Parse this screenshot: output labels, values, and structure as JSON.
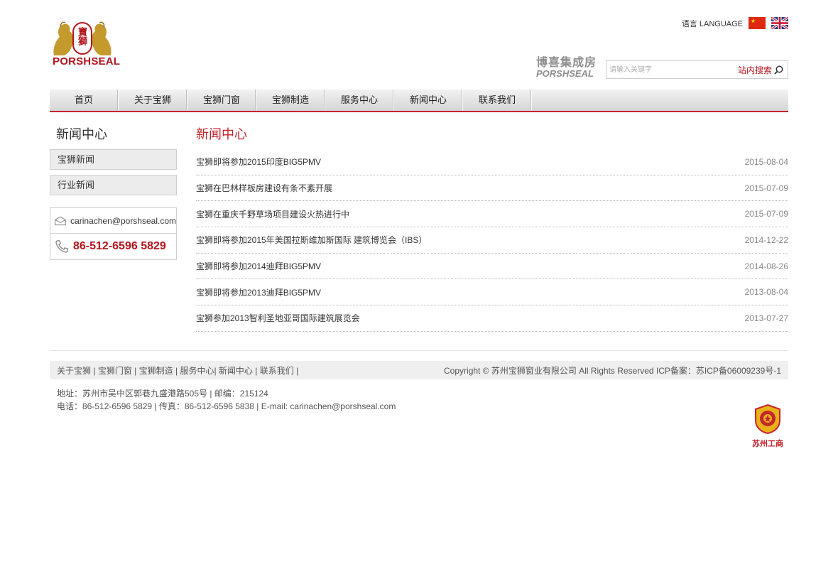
{
  "header": {
    "brand_name": "PORSHSEAL",
    "logo_seal_text": "寶獅",
    "language_label": "语言 LANGUAGE",
    "sub_brand_cn": "博喜集成房",
    "sub_brand_en": "PORSHSEAL",
    "search_placeholder": "请输入关键字",
    "search_button": "站内搜索"
  },
  "nav": {
    "items": [
      "首页",
      "关于宝狮",
      "宝狮门窗",
      "宝狮制造",
      "服务中心",
      "新闻中心",
      "联系我们"
    ]
  },
  "sidebar": {
    "title": "新闻中心",
    "links": [
      "宝狮新闻",
      "行业新闻"
    ],
    "email": "carinachen@porshseal.com",
    "phone": "86-512-6596 5829"
  },
  "main": {
    "title": "新闻中心",
    "news": [
      {
        "title": "宝狮即将参加2015印度BIG5PMV",
        "date": "2015-08-04"
      },
      {
        "title": "宝狮在巴林样板房建设有条不紊开展",
        "date": "2015-07-09"
      },
      {
        "title": "宝狮在重庆千野草场项目建设火热进行中",
        "date": "2015-07-09"
      },
      {
        "title": "宝狮即将参加2015年美国拉斯维加斯国际 建筑博览会（IBS）",
        "date": "2014-12-22"
      },
      {
        "title": "宝狮即将参加2014迪拜BIG5PMV",
        "date": "2014-08-26"
      },
      {
        "title": "宝狮即将参加2013迪拜BIG5PMV",
        "date": "2013-08-04"
      },
      {
        "title": "宝狮参加2013智利圣地亚哥国际建筑展览会",
        "date": "2013-07-27"
      }
    ]
  },
  "footer": {
    "links": [
      "关于宝狮",
      "宝狮门窗",
      "宝狮制造",
      "服务中心",
      "新闻中心",
      "联系我们"
    ],
    "copyright": "Copyright © 苏州宝狮窗业有限公司 All Rights Reserved ICP备案：苏ICP备06009239号-1",
    "address": "地址：苏州市吴中区郭巷九盛港路505号 | 邮编：215124",
    "contact": "电话：86-512-6596 5829 | 传真：86-512-6596 5838 | E-mail: carinachen@porshseal.com",
    "badge_text": "苏州工商"
  },
  "colors": {
    "brand_red": "#c5252c",
    "gold": "#b8901f"
  }
}
